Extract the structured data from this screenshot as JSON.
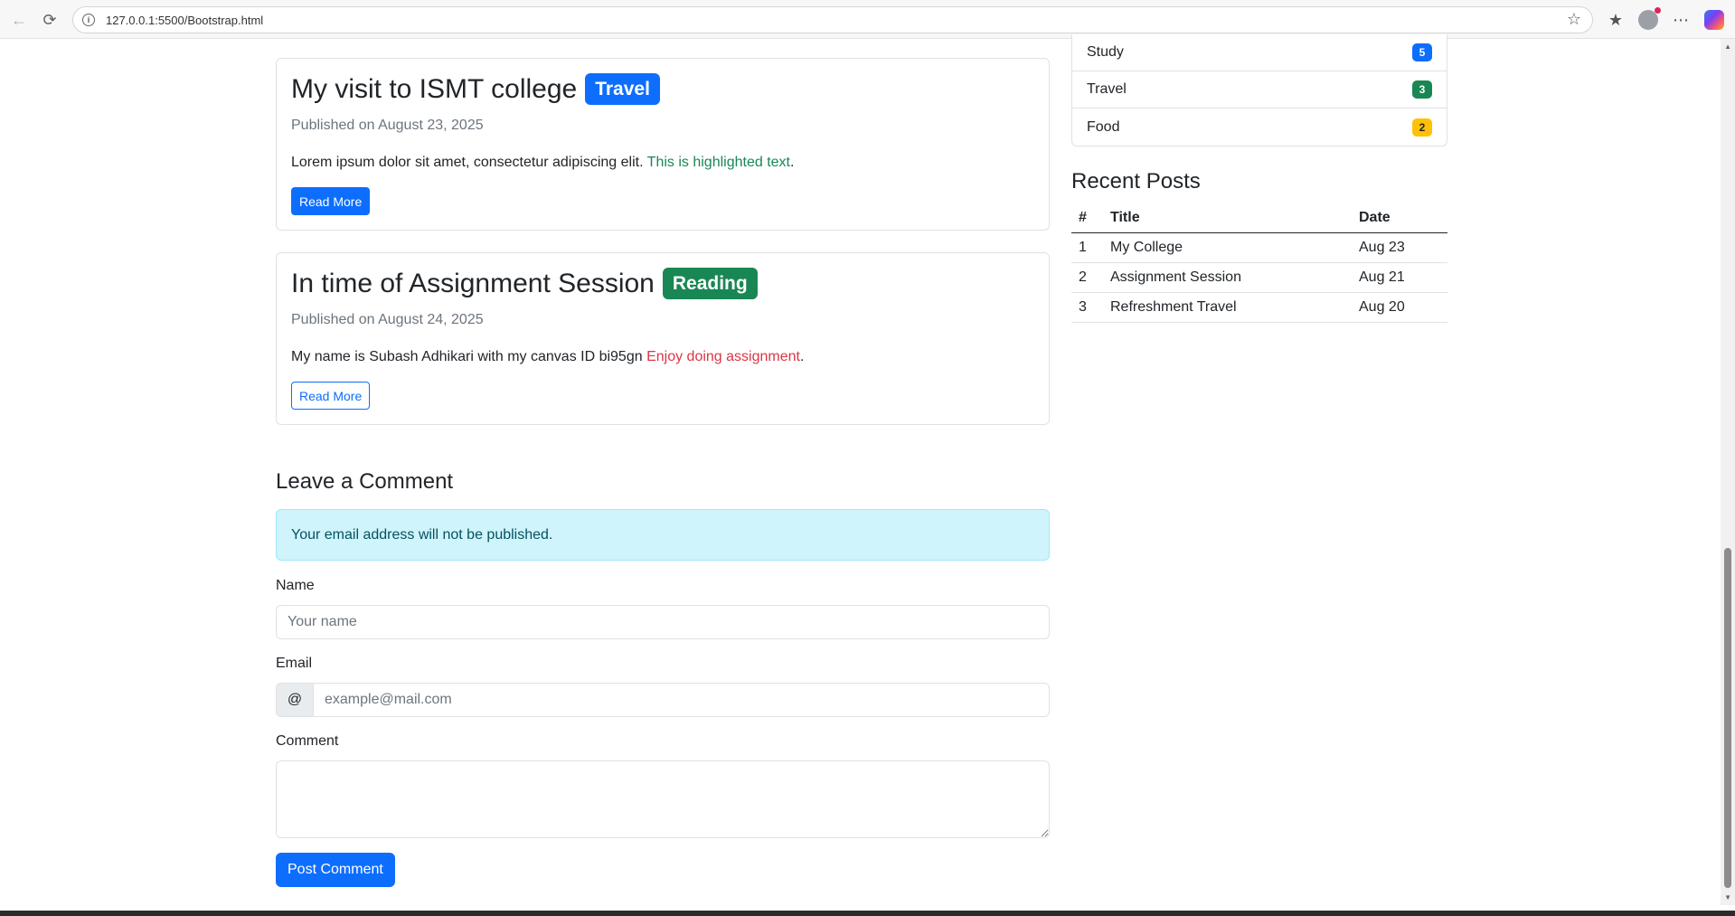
{
  "browser": {
    "url": "127.0.0.1:5500/Bootstrap.html"
  },
  "posts": [
    {
      "title": "My visit to ISMT college",
      "badge": "Travel",
      "badge_color": "#0d6efd",
      "meta": "Published on August 23, 2025",
      "text": "Lorem ipsum dolor sit amet, consectetur adipiscing elit. ",
      "highlight": "This is highlighted text",
      "highlight_color": "#198754",
      "end": ".",
      "button": "Read More"
    },
    {
      "title": "In time of Assignment Session",
      "badge": "Reading",
      "badge_color": "#198754",
      "meta": "Published on August 24, 2025",
      "text": "My name is Subash Adhikari with my canvas ID bi95gn ",
      "highlight": "Enjoy doing assignment",
      "highlight_color": "#dc3545",
      "end": ".",
      "button": "Read More"
    }
  ],
  "comment": {
    "title": "Leave a Comment",
    "alert": "Your email address will not be published.",
    "name_label": "Name",
    "name_placeholder": "Your name",
    "email_label": "Email",
    "email_addon": "@",
    "email_placeholder": "example@mail.com",
    "comment_label": "Comment",
    "submit": "Post Comment"
  },
  "sidebar": {
    "categories": [
      {
        "name": "Study",
        "count": "5",
        "color": "#0d6efd"
      },
      {
        "name": "Travel",
        "count": "3",
        "color": "#198754"
      },
      {
        "name": "Food",
        "count": "2",
        "color": "#ffc107"
      }
    ],
    "recent_title": "Recent Posts",
    "table": {
      "headers": [
        "#",
        "Title",
        "Date"
      ],
      "rows": [
        [
          "1",
          "My College",
          "Aug 23"
        ],
        [
          "2",
          "Assignment Session",
          "Aug 21"
        ],
        [
          "3",
          "Refreshment Travel",
          "Aug 20"
        ]
      ]
    }
  }
}
